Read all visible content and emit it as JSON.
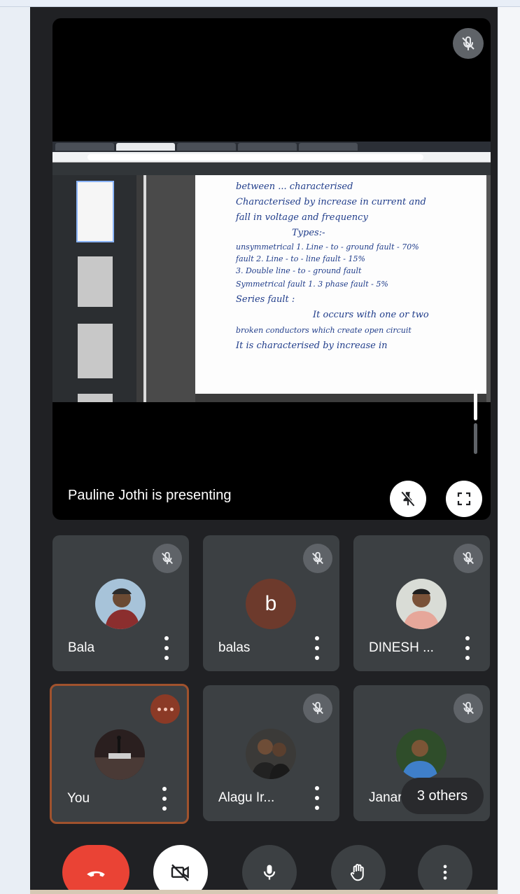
{
  "presentation": {
    "presenter_label": "Pauline Jothi is presenting",
    "shared_notes": [
      "between ... characterised",
      "Characterised by increase in current and",
      "fall in voltage and frequency",
      "Types:-",
      "unsymmetrical  1. Line - to - ground fault - 70%",
      "fault          2. Line - to - line fault - 15%",
      "               3. Double line - to - ground fault",
      "Symmetrical fault  1. 3 phase fault - 5%",
      "Series fault :",
      "It occurs with one or two",
      "broken conductors which create open circuit",
      "It is characterised by increase in"
    ]
  },
  "participants": [
    {
      "name": "Bala",
      "avatar_type": "photo",
      "mic_state": "muted"
    },
    {
      "name": "balas",
      "avatar_type": "letter",
      "avatar_letter": "b",
      "mic_state": "muted"
    },
    {
      "name": "DINESH ...",
      "avatar_type": "photo",
      "mic_state": "muted"
    },
    {
      "name": "You",
      "avatar_type": "photo",
      "mic_state": "speaking"
    },
    {
      "name": "Alagu Ir...",
      "avatar_type": "photo",
      "mic_state": "muted"
    },
    {
      "name": "Janar",
      "avatar_type": "photo",
      "mic_state": "muted"
    }
  ],
  "others_pill": "3 others",
  "controls": {
    "end_call_icon": "phone-hangup-icon",
    "camera_icon": "camera-off-icon",
    "mic_icon": "microphone-icon",
    "raise_hand_icon": "hand-icon",
    "more_icon": "more-vertical-icon"
  },
  "colors": {
    "end_call": "#ea4335",
    "tile_background": "#3c4043",
    "app_background": "#202124",
    "self_border": "#a0522d"
  }
}
